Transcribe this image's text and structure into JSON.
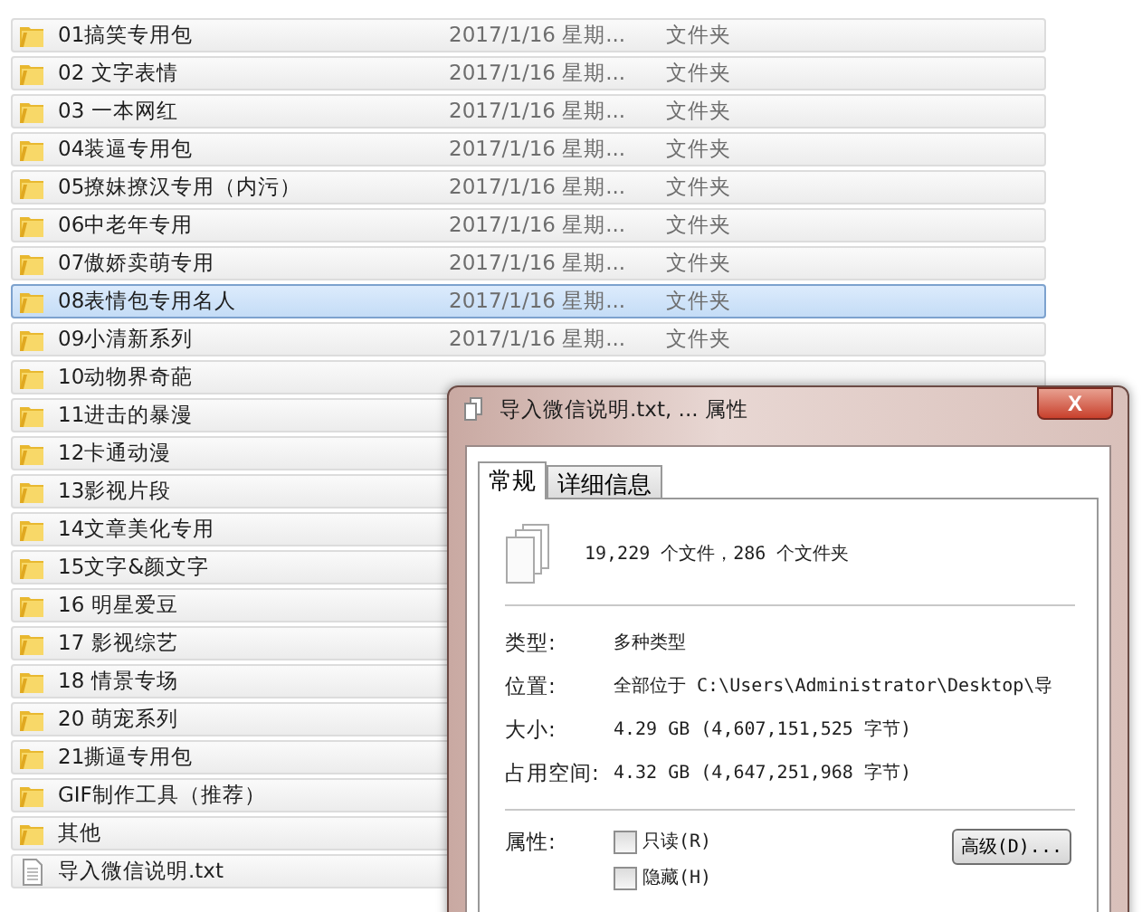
{
  "rows": [
    {
      "kind": "folder",
      "name": "01搞笑专用包",
      "date": "2017/1/16 星期...",
      "type": "文件夹",
      "selected": false
    },
    {
      "kind": "folder",
      "name": "02 文字表情",
      "date": "2017/1/16 星期...",
      "type": "文件夹",
      "selected": false
    },
    {
      "kind": "folder",
      "name": "03 一本网红",
      "date": "2017/1/16 星期...",
      "type": "文件夹",
      "selected": false
    },
    {
      "kind": "folder",
      "name": "04装逼专用包",
      "date": "2017/1/16 星期...",
      "type": "文件夹",
      "selected": false
    },
    {
      "kind": "folder",
      "name": "05撩妹撩汉专用（内污）",
      "date": "2017/1/16 星期...",
      "type": "文件夹",
      "selected": false
    },
    {
      "kind": "folder",
      "name": "06中老年专用",
      "date": "2017/1/16 星期...",
      "type": "文件夹",
      "selected": false
    },
    {
      "kind": "folder",
      "name": "07傲娇卖萌专用",
      "date": "2017/1/16 星期...",
      "type": "文件夹",
      "selected": false
    },
    {
      "kind": "folder",
      "name": "08表情包专用名人",
      "date": "2017/1/16 星期...",
      "type": "文件夹",
      "selected": true
    },
    {
      "kind": "folder",
      "name": "09小清新系列",
      "date": "2017/1/16 星期...",
      "type": "文件夹",
      "selected": false
    },
    {
      "kind": "folder",
      "name": "10动物界奇葩",
      "selected": false
    },
    {
      "kind": "folder",
      "name": "11进击的暴漫",
      "selected": false
    },
    {
      "kind": "folder",
      "name": "12卡通动漫",
      "selected": false
    },
    {
      "kind": "folder",
      "name": "13影视片段",
      "selected": false
    },
    {
      "kind": "folder",
      "name": "14文章美化专用",
      "selected": false
    },
    {
      "kind": "folder",
      "name": "15文字&颜文字",
      "selected": false
    },
    {
      "kind": "folder",
      "name": "16 明星爱豆",
      "selected": false
    },
    {
      "kind": "folder",
      "name": "17 影视综艺",
      "selected": false
    },
    {
      "kind": "folder",
      "name": "18 情景专场",
      "selected": false
    },
    {
      "kind": "folder",
      "name": "20 萌宠系列",
      "selected": false
    },
    {
      "kind": "folder",
      "name": "21撕逼专用包",
      "selected": false
    },
    {
      "kind": "folder",
      "name": "GIF制作工具（推荐）",
      "selected": false
    },
    {
      "kind": "folder",
      "name": "其他",
      "selected": false
    },
    {
      "kind": "file",
      "name": "导入微信说明.txt",
      "selected": false
    }
  ],
  "dialog": {
    "title": "导入微信说明.txt, ... 属性",
    "close": "X",
    "tabs": [
      {
        "label": "常规",
        "selected": true
      },
      {
        "label": "详细信息",
        "selected": false
      }
    ],
    "summary": "19,229 个文件，286 个文件夹",
    "properties": [
      {
        "label": "类型:",
        "value": "多种类型"
      },
      {
        "label": "位置:",
        "value": "全部位于 C:\\Users\\Administrator\\Desktop\\导"
      },
      {
        "label": "大小:",
        "value": "4.29 GB (4,607,151,525 字节)"
      },
      {
        "label": "占用空间:",
        "value": "4.32 GB (4,647,251,968 字节)"
      }
    ],
    "attributes_label": "属性:",
    "attributes": [
      {
        "label": "只读(R)",
        "checked": false
      },
      {
        "label": "隐藏(H)",
        "checked": false
      }
    ],
    "advanced_button": "高级(D)..."
  }
}
